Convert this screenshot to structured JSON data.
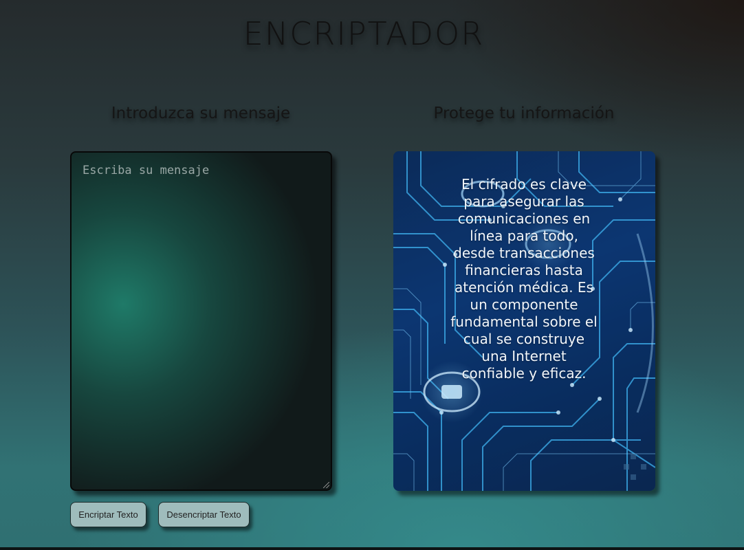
{
  "header": {
    "title": "ENCRIPTADOR"
  },
  "left": {
    "heading": "Introduzca su mensaje",
    "input": {
      "placeholder": "Escriba su mensaje",
      "value": ""
    },
    "buttons": {
      "encrypt_label": "Encriptar Texto",
      "decrypt_label": "Desencriptar Texto"
    }
  },
  "right": {
    "heading": "Protege tu información",
    "card_text": "El cifrado es clave para asegurar las comunicaciones en línea para todo, desde transacciones financieras hasta atención médica. Es un componente fundamental sobre el cual se construye una Internet confiable y eficaz."
  },
  "colors": {
    "button_bg": "#9fbcbc",
    "textarea_glow": "#1f7a68",
    "card_blue": "#0d3a78"
  }
}
